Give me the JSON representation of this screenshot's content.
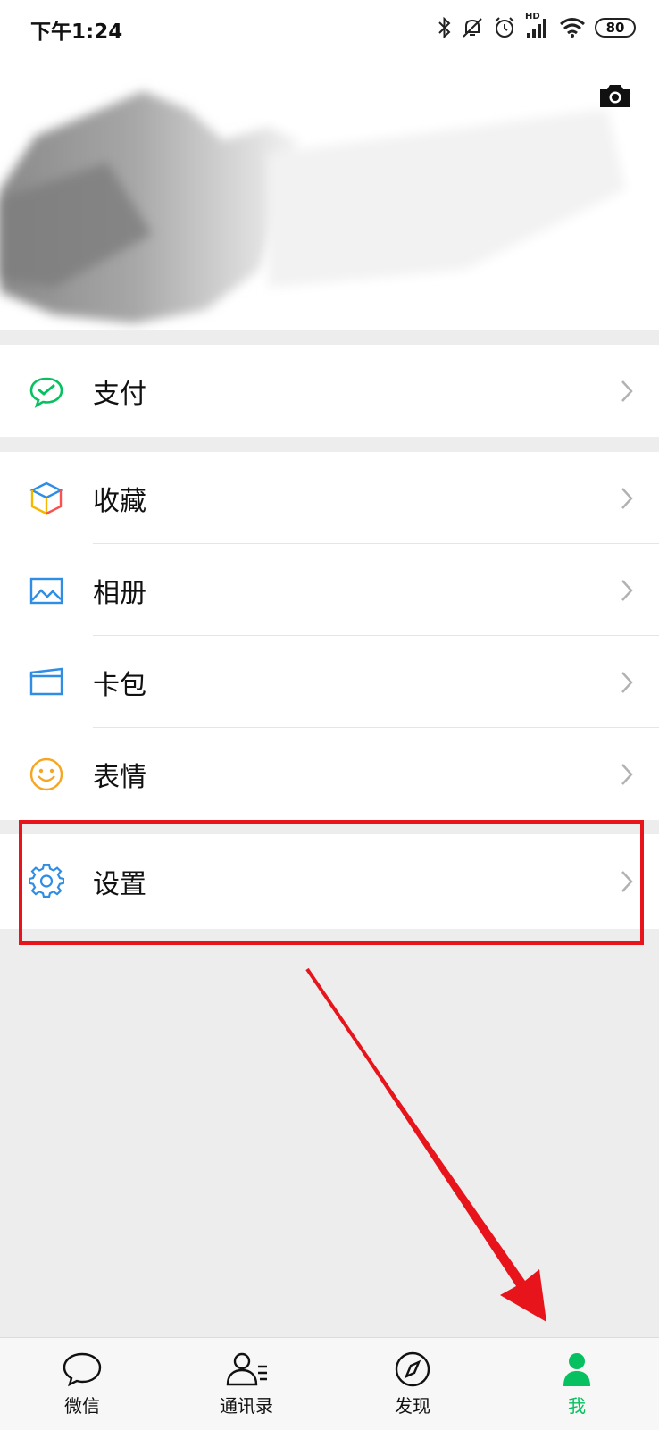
{
  "status_bar": {
    "time": "下午1:24",
    "hd_label": "HD",
    "battery": "80",
    "icons": [
      "bluetooth-icon",
      "mute-icon",
      "alarm-icon",
      "signal-icon",
      "wifi-icon",
      "battery-icon"
    ]
  },
  "profile": {
    "camera_icon": "camera-icon"
  },
  "menu": {
    "pay": {
      "label": "支付",
      "icon": "wechat-pay-icon"
    },
    "favorites": {
      "label": "收藏",
      "icon": "favorites-cube-icon"
    },
    "album": {
      "label": "相册",
      "icon": "album-icon"
    },
    "cards": {
      "label": "卡包",
      "icon": "card-wallet-icon"
    },
    "stickers": {
      "label": "表情",
      "icon": "smiley-icon"
    },
    "settings": {
      "label": "设置",
      "icon": "gear-icon"
    }
  },
  "tabbar": {
    "chats": "微信",
    "contacts": "通讯录",
    "discover": "发现",
    "me": "我"
  },
  "colors": {
    "accent": "#07c160",
    "highlight": "#e8141b",
    "background": "#ededed"
  }
}
